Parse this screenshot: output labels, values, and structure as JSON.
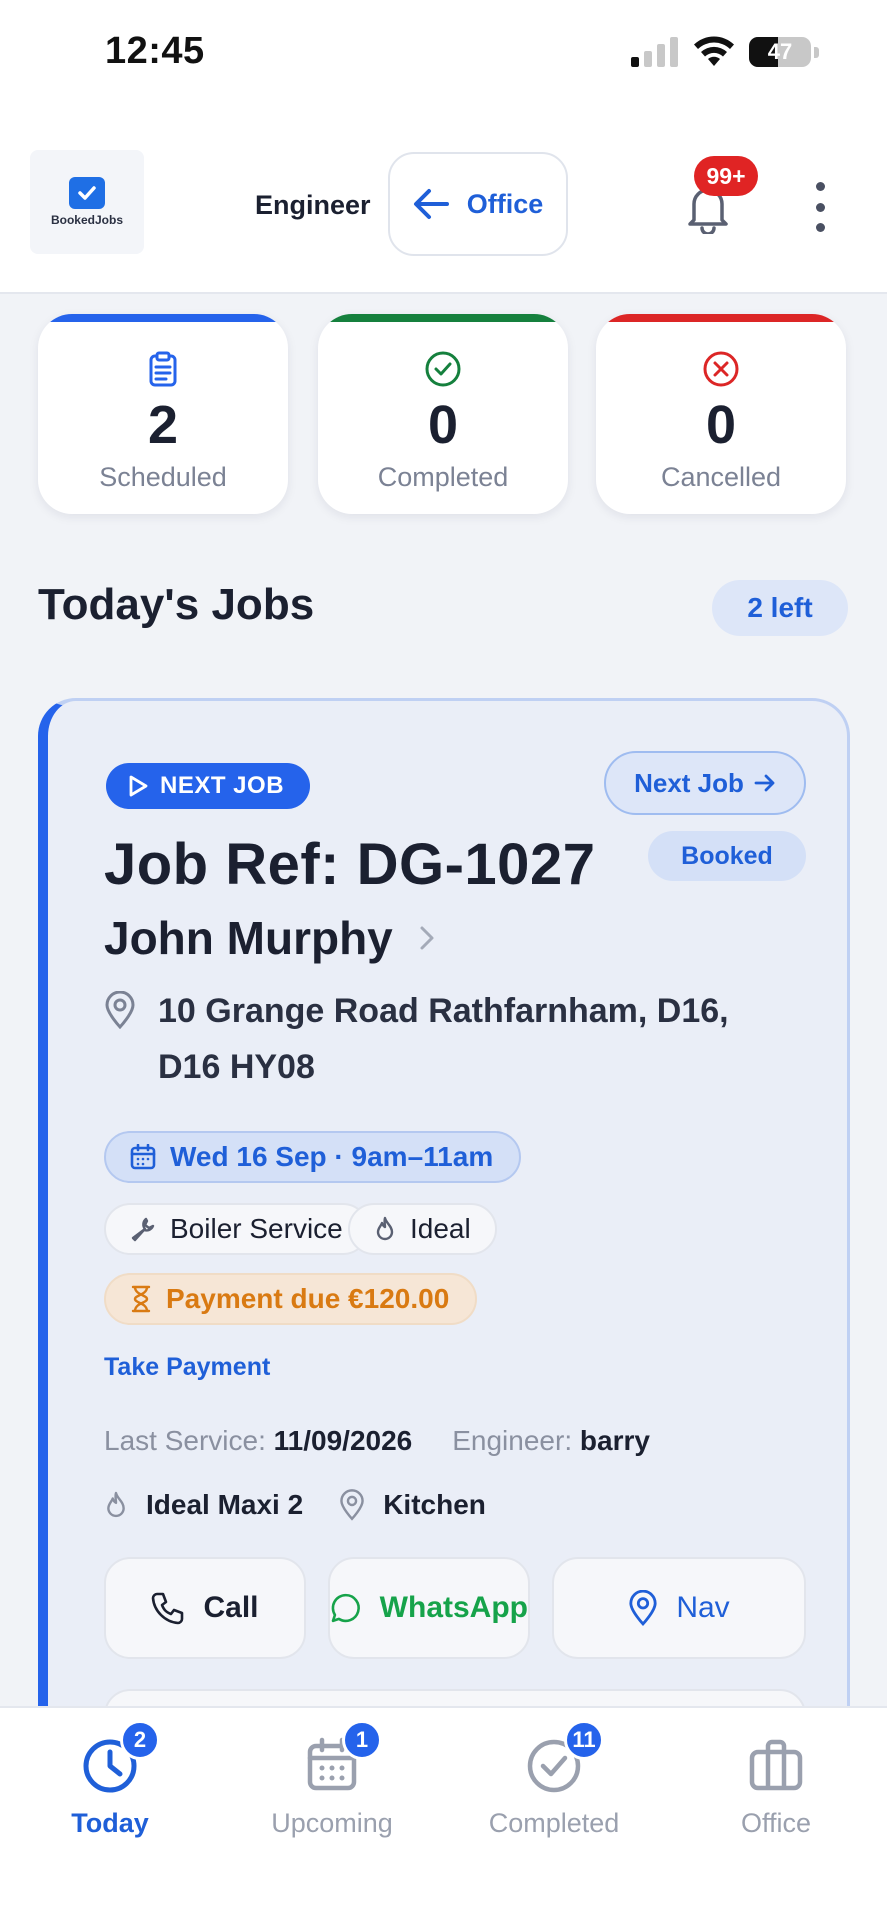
{
  "status_bar": {
    "time": "12:45",
    "battery": "47"
  },
  "header": {
    "logo_text": "BookedJobs",
    "role": "Engineer",
    "office_button": "Office",
    "notifications_badge": "99+"
  },
  "stats": [
    {
      "value": "2",
      "label": "Scheduled",
      "color": "#2563eb"
    },
    {
      "value": "0",
      "label": "Completed",
      "color": "#15803d"
    },
    {
      "value": "0",
      "label": "Cancelled",
      "color": "#dc2626"
    }
  ],
  "today": {
    "title": "Today's Jobs",
    "remaining": "2 left"
  },
  "job": {
    "tag": "NEXT JOB",
    "next_button": "Next Job",
    "status": "Booked",
    "ref": "Job Ref: DG-1027",
    "customer": "John Murphy",
    "address_line1": "10 Grange Road Rathfarnham, D16,",
    "address_line2": "D16 HY08",
    "date": "Wed 16 Sep · 9am–11am",
    "service": "Boiler Service",
    "brand": "Ideal",
    "payment": "Payment due €120.00",
    "take_payment": "Take Payment",
    "last_service_key": "Last Service:",
    "last_service_val": "11/09/2026",
    "engineer_key": "Engineer:",
    "engineer_val": "barry",
    "boiler_model": "Ideal Maxi 2",
    "location": "Kitchen",
    "actions": {
      "call": "Call",
      "whatsapp": "WhatsApp",
      "nav": "Nav"
    }
  },
  "bottom_nav": [
    {
      "label": "Today",
      "badge": "2",
      "active": true
    },
    {
      "label": "Upcoming",
      "badge": "1",
      "active": false
    },
    {
      "label": "Completed",
      "badge": "11",
      "active": false
    },
    {
      "label": "Office",
      "badge": "",
      "active": false
    }
  ],
  "colors": {
    "accent": "#2563eb",
    "success": "#15803d",
    "danger": "#dc2626",
    "warning": "#d97a12",
    "whatsapp": "#16a34a"
  }
}
